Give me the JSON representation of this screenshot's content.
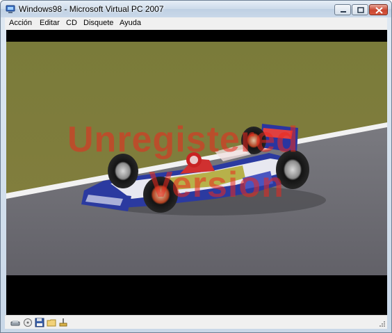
{
  "window": {
    "title": "Windows98 - Microsoft Virtual PC 2007",
    "icon": "virtual-pc-app-icon",
    "controls": {
      "minimize": "minimize-icon",
      "maximize": "maximize-icon",
      "close": "close-icon"
    }
  },
  "menu": {
    "items": [
      {
        "label": "Acción"
      },
      {
        "label": "Editar"
      },
      {
        "label": "CD"
      },
      {
        "label": "Disquete"
      },
      {
        "label": "Ayuda"
      }
    ]
  },
  "guest": {
    "description_hidden": false,
    "watermark": {
      "line1": "Unregistered",
      "line2": "Version"
    },
    "colors": {
      "grass": "#7c7a3c",
      "track": "#6e6d74",
      "car_blue": "#2b3aa0",
      "car_red": "#c8201e",
      "watermark": "#eb281e"
    }
  },
  "status": {
    "icons": [
      "hard-disk-icon",
      "cd-drive-icon",
      "floppy-icon",
      "shared-folder-icon",
      "network-icon"
    ]
  }
}
